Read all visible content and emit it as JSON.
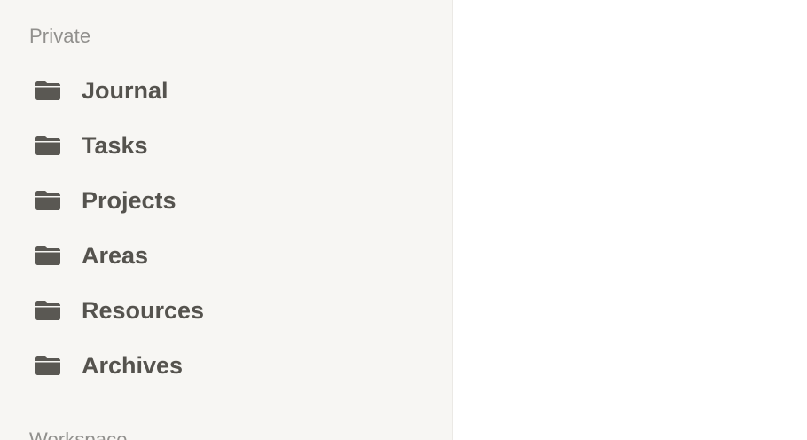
{
  "sidebar": {
    "section_title": "Private",
    "next_section_title": "Workspace",
    "items": [
      {
        "label": "Journal",
        "icon": "folder-icon"
      },
      {
        "label": "Tasks",
        "icon": "folder-icon"
      },
      {
        "label": "Projects",
        "icon": "folder-icon"
      },
      {
        "label": "Areas",
        "icon": "folder-icon"
      },
      {
        "label": "Resources",
        "icon": "folder-icon"
      },
      {
        "label": "Archives",
        "icon": "folder-icon"
      }
    ]
  },
  "colors": {
    "sidebar_bg": "#f7f6f3",
    "label_text": "#55534e",
    "section_text": "#91908d",
    "icon_fill": "#5a5853",
    "main_bg": "#ffffff"
  }
}
